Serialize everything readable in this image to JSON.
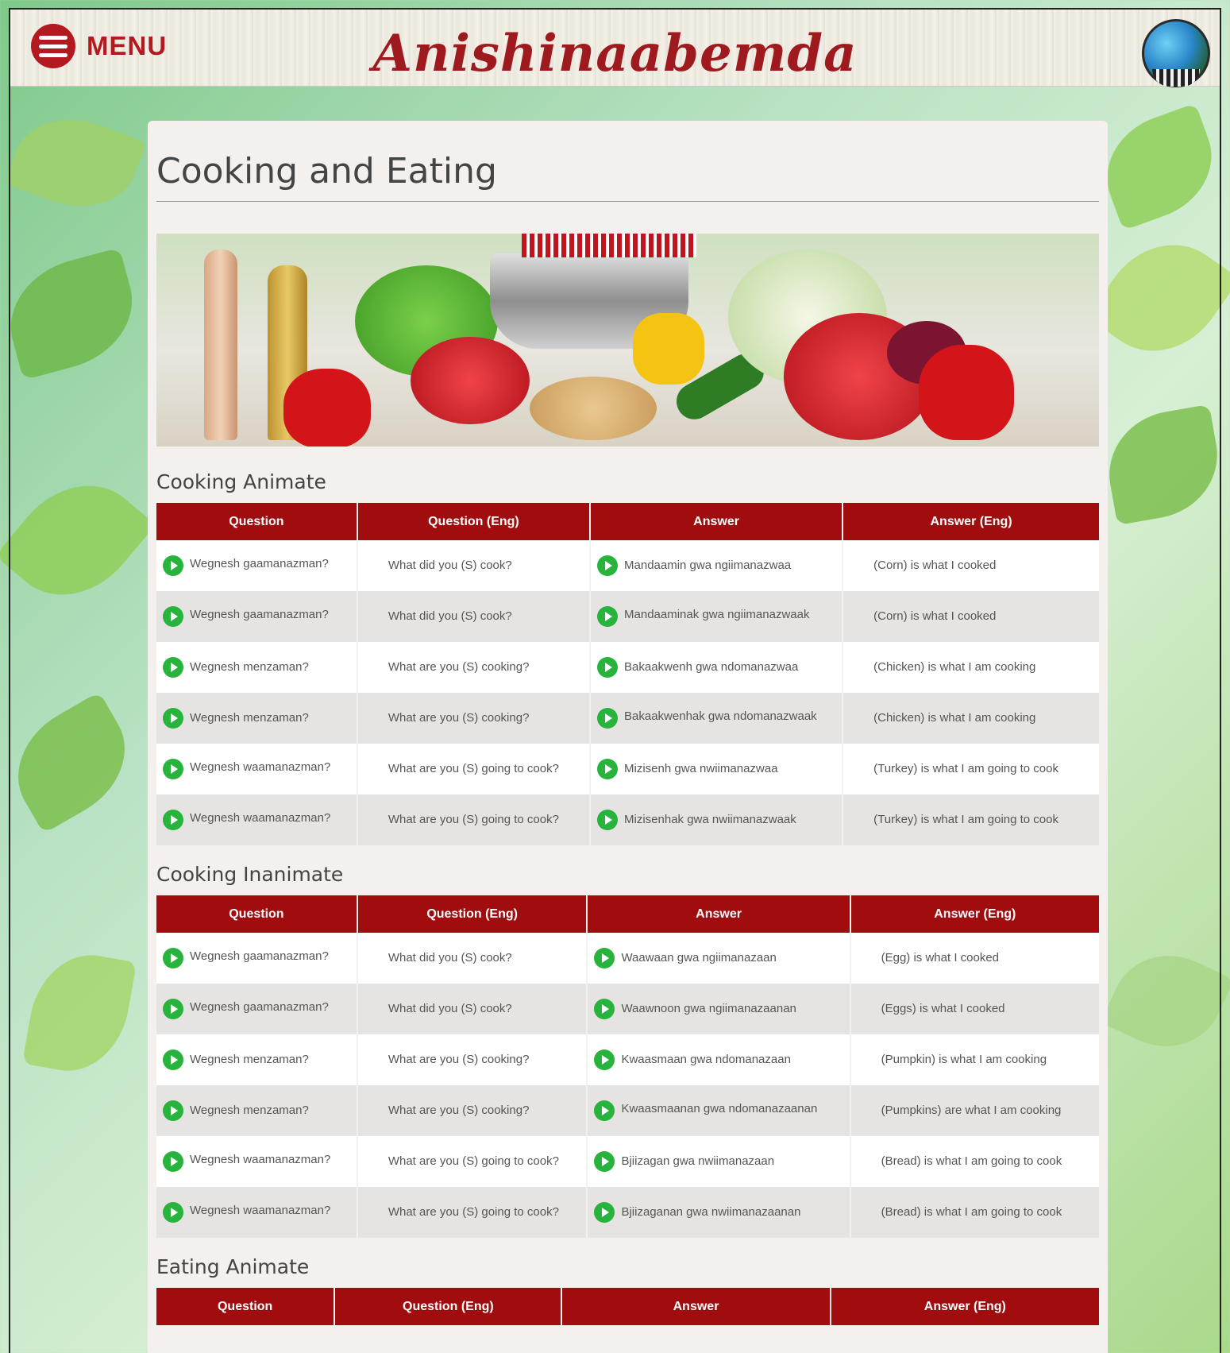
{
  "header": {
    "menu_label": "MENU",
    "brand": "Anishinaabemda",
    "logo_icon": "globe-logo-icon"
  },
  "page": {
    "title": "Cooking and Eating"
  },
  "columns": [
    "Question",
    "Question (Eng)",
    "Answer",
    "Answer (Eng)"
  ],
  "sections": [
    {
      "title": "Cooking Animate",
      "rows": [
        {
          "q": "Wegnesh gaamanazman?",
          "qe": "What did you (S) cook?",
          "a": "Mandaamin gwa ngiimanazwaa",
          "ae": "(Corn) is what I cooked"
        },
        {
          "q": "Wegnesh gaamanazman?",
          "qe": "What did you (S) cook?",
          "a": "Mandaaminak gwa ngiimanazwaak",
          "ae": "(Corn) is what I cooked"
        },
        {
          "q": "Wegnesh menzaman?",
          "qe": "What are you (S) cooking?",
          "a": "Bakaakwenh gwa ndomanazwaa",
          "ae": "(Chicken) is what I am cooking"
        },
        {
          "q": "Wegnesh menzaman?",
          "qe": "What are you (S) cooking?",
          "a": "Bakaakwenhak gwa ndomanazwaak",
          "ae": "(Chicken) is what I am cooking"
        },
        {
          "q": "Wegnesh waamanazman?",
          "qe": "What are you (S) going to cook?",
          "a": "Mizisenh gwa nwiimanazwaa",
          "ae": "(Turkey) is what I am going to cook"
        },
        {
          "q": "Wegnesh waamanazman?",
          "qe": "What are you (S) going to cook?",
          "a": "Mizisenhak gwa nwiimanazwaak",
          "ae": "(Turkey) is what I am going to cook"
        }
      ]
    },
    {
      "title": "Cooking Inanimate",
      "rows": [
        {
          "q": "Wegnesh gaamanazman?",
          "qe": "What did you (S) cook?",
          "a": "Waawaan gwa ngiimanazaan",
          "ae": "(Egg) is what I cooked"
        },
        {
          "q": "Wegnesh gaamanazman?",
          "qe": "What did you (S) cook?",
          "a": "Waawnoon gwa ngiimanazaanan",
          "ae": "(Eggs) is what I cooked"
        },
        {
          "q": "Wegnesh menzaman?",
          "qe": "What are you (S) cooking?",
          "a": "Kwaasmaan gwa ndomanazaan",
          "ae": "(Pumpkin) is what I am cooking"
        },
        {
          "q": "Wegnesh menzaman?",
          "qe": "What are you (S) cooking?",
          "a": "Kwaasmaanan gwa ndomanazaanan",
          "ae": "(Pumpkins) are what I am cooking"
        },
        {
          "q": "Wegnesh waamanazman?",
          "qe": "What are you (S) going to cook?",
          "a": "Bjiizagan gwa nwiimanazaan",
          "ae": "(Bread) is what I am going to cook"
        },
        {
          "q": "Wegnesh waamanazman?",
          "qe": "What are you (S) going to cook?",
          "a": "Bjiizaganan gwa nwiimanazaanan",
          "ae": "(Bread) is what I am going to cook"
        }
      ]
    },
    {
      "title": "Eating Animate",
      "rows": []
    }
  ]
}
